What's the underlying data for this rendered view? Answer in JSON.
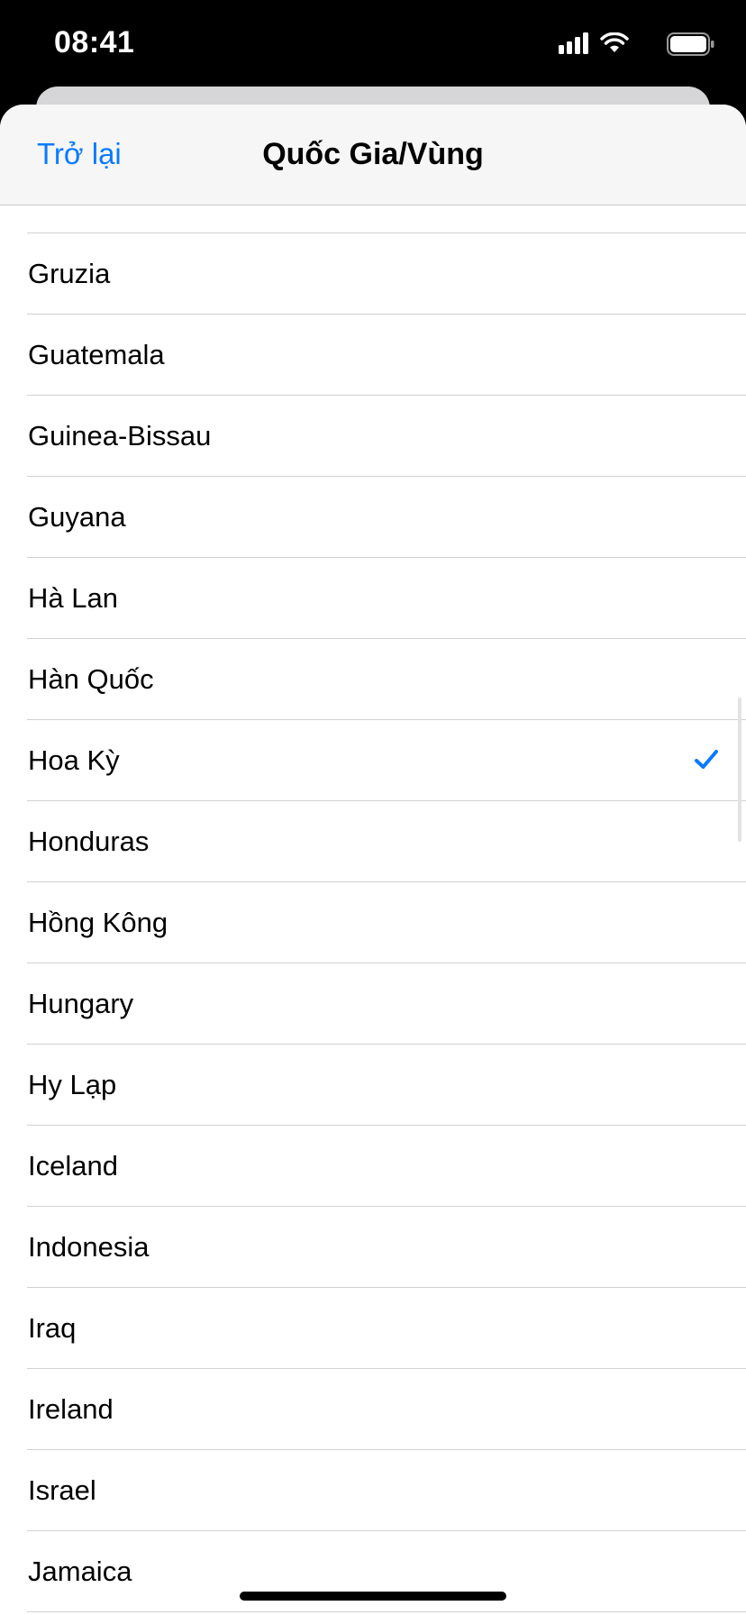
{
  "status_bar": {
    "time": "08:41"
  },
  "nav": {
    "back_label": "Trở lại",
    "title": "Quốc Gia/Vùng"
  },
  "countries": [
    {
      "label": "Gruzia",
      "selected": false
    },
    {
      "label": "Guatemala",
      "selected": false
    },
    {
      "label": "Guinea-Bissau",
      "selected": false
    },
    {
      "label": "Guyana",
      "selected": false
    },
    {
      "label": "Hà Lan",
      "selected": false
    },
    {
      "label": "Hàn Quốc",
      "selected": false
    },
    {
      "label": "Hoa Kỳ",
      "selected": true
    },
    {
      "label": "Honduras",
      "selected": false
    },
    {
      "label": "Hồng Kông",
      "selected": false
    },
    {
      "label": "Hungary",
      "selected": false
    },
    {
      "label": "Hy Lạp",
      "selected": false
    },
    {
      "label": "Iceland",
      "selected": false
    },
    {
      "label": "Indonesia",
      "selected": false
    },
    {
      "label": "Iraq",
      "selected": false
    },
    {
      "label": "Ireland",
      "selected": false
    },
    {
      "label": "Israel",
      "selected": false
    },
    {
      "label": "Jamaica",
      "selected": false
    }
  ],
  "colors": {
    "accent": "#0a7aff",
    "separator": "#d1d1d6",
    "nav_background": "#f6f6f6"
  },
  "icons": {
    "signal": "cellular-signal-icon",
    "wifi": "wifi-icon",
    "battery": "battery-icon",
    "check": "checkmark-icon"
  }
}
